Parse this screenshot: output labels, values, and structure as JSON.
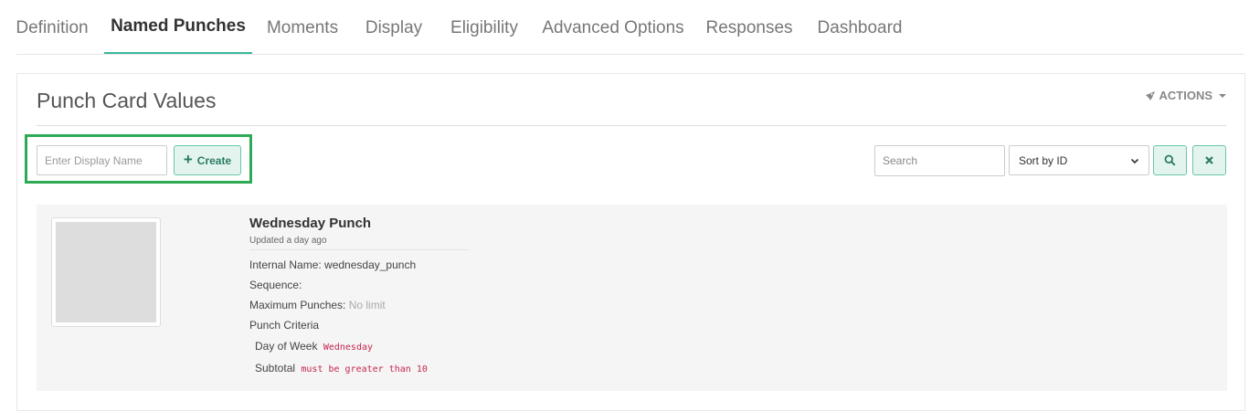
{
  "tabs": [
    {
      "label": "Definition",
      "active": false
    },
    {
      "label": "Named Punches",
      "active": true
    },
    {
      "label": "Moments",
      "active": false
    },
    {
      "label": "Display",
      "active": false
    },
    {
      "label": "Eligibility",
      "active": false
    },
    {
      "label": "Advanced Options",
      "active": false
    },
    {
      "label": "Responses",
      "active": false
    },
    {
      "label": "Dashboard",
      "active": false
    }
  ],
  "panel": {
    "title": "Punch Card Values",
    "actions_label": "ACTIONS",
    "actions_icon": "rocket-icon"
  },
  "create": {
    "placeholder": "Enter Display Name",
    "button_label": "Create"
  },
  "filter": {
    "search_placeholder": "Search",
    "sort_selected": "Sort by ID"
  },
  "punches": [
    {
      "name": "Wednesday Punch",
      "updated": "Updated a day ago",
      "internal_name_label": "Internal Name:",
      "internal_name": "wednesday_punch",
      "sequence_label": "Sequence:",
      "max_label": "Maximum Punches:",
      "max_value": "No limit",
      "criteria_label": "Punch Criteria",
      "criteria": [
        {
          "field": "Day of Week",
          "value": "Wednesday"
        },
        {
          "field": "Subtotal",
          "value": "must be greater than 10"
        }
      ]
    }
  ],
  "colors": {
    "accent": "#3bb89b",
    "highlight": "#2eaa55",
    "code": "#c7254e"
  }
}
